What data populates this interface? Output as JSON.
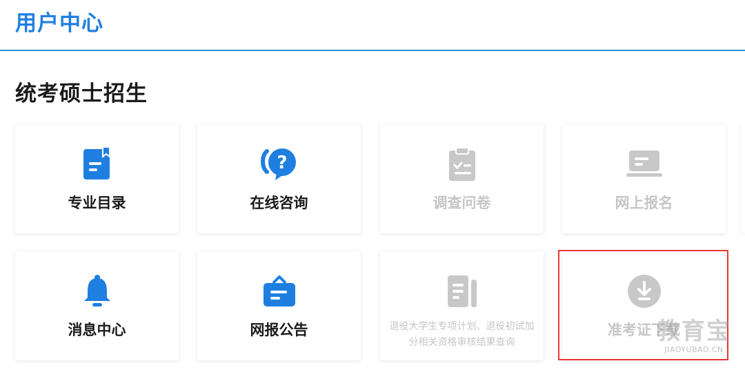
{
  "header": {
    "title": "用户中心"
  },
  "section": {
    "title": "统考硕士招生"
  },
  "colors": {
    "accent": "#1e7fe0",
    "icon_active": "#1e7fe0",
    "icon_disabled": "#c8c8c8",
    "highlight": "#e53935"
  },
  "cards": [
    {
      "label": "专业目录",
      "icon": "bookmark-document-icon",
      "enabled": true
    },
    {
      "label": "在线咨询",
      "icon": "question-chat-icon",
      "enabled": true
    },
    {
      "label": "调查问卷",
      "icon": "clipboard-checklist-icon",
      "enabled": false
    },
    {
      "label": "网上报名",
      "icon": "laptop-icon",
      "enabled": false
    },
    {
      "label": "消息中心",
      "icon": "bell-icon",
      "enabled": true
    },
    {
      "label": "网报公告",
      "icon": "notice-board-icon",
      "enabled": true
    },
    {
      "label": "退役大学生专项计划、退役初试加分相关资格审核结果查询",
      "icon": "document-list-icon",
      "enabled": false
    },
    {
      "label": "准考证下载",
      "icon": "download-circle-icon",
      "enabled": false
    }
  ],
  "watermark": {
    "big": "教育宝",
    "small": "JIAOYUBAO.CN"
  }
}
